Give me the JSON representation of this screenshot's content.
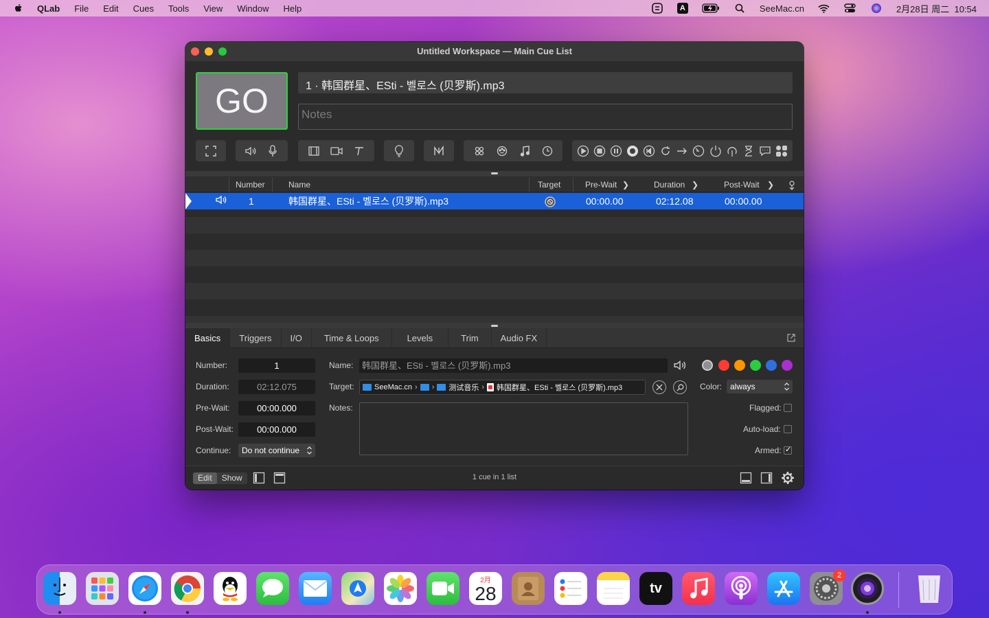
{
  "menubar": {
    "app_name": "QLab",
    "items": [
      "File",
      "Edit",
      "Cues",
      "Tools",
      "View",
      "Window",
      "Help"
    ],
    "status": {
      "site": "SeeMac.cn",
      "datetime": "2月28日 周二  10:54",
      "input_source": "A"
    }
  },
  "window": {
    "title": "Untitled Workspace — Main Cue List",
    "go_label": "GO",
    "current_cue": "1 · 韩国群星、ESti - 벨로스 (贝罗斯).mp3",
    "notes_placeholder": "Notes"
  },
  "toolbar": {
    "groups": [
      [
        "fullscreen-icon"
      ],
      [
        "audio-cue-icon",
        "mic-cue-icon"
      ],
      [
        "video-cue-icon",
        "camera-cue-icon",
        "text-cue-icon"
      ],
      [
        "light-cue-icon"
      ],
      [
        "fade-cue-icon"
      ],
      [
        "network-cue-icon",
        "midi-cue-icon",
        "music-cue-icon",
        "timecode-cue-icon"
      ],
      [
        "start-icon",
        "stop-icon",
        "pause-icon",
        "load-icon",
        "reset-icon",
        "devamp-icon",
        "goto-icon",
        "target-icon",
        "arm-icon",
        "disarm-icon",
        "wait-icon",
        "memo-icon",
        "group-icon"
      ]
    ]
  },
  "cue_list": {
    "columns": [
      "Number",
      "Name",
      "Target",
      "Pre-Wait",
      "Duration",
      "Post-Wait"
    ],
    "rows": [
      {
        "number": "1",
        "name": "韩国群星、ESti - 벨로스 (贝罗斯).mp3",
        "pre_wait": "00:00.00",
        "duration": "02:12.08",
        "post_wait": "00:00.00",
        "selected": true
      }
    ]
  },
  "inspector": {
    "tabs": [
      "Basics",
      "Triggers",
      "I/O",
      "Time & Loops",
      "Levels",
      "Trim",
      "Audio FX"
    ],
    "active_tab": "Basics",
    "labels": {
      "number": "Number:",
      "duration": "Duration:",
      "pre_wait": "Pre-Wait:",
      "post_wait": "Post-Wait:",
      "continue": "Continue:",
      "name": "Name:",
      "target": "Target:",
      "notes": "Notes:",
      "color": "Color:",
      "flagged": "Flagged:",
      "auto_load": "Auto-load:",
      "armed": "Armed:"
    },
    "values": {
      "number": "1",
      "duration": "02:12.075",
      "pre_wait": "00:00.000",
      "post_wait": "00:00.000",
      "continue": "Do not continue",
      "name": "韩国群星、ESti - 벨로스 (贝罗斯).mp3",
      "color_mode": "always"
    },
    "target_path": [
      "SeeMac.cn",
      "",
      "测试音乐",
      "韩国群星、ESti - 벨로스 (贝罗斯).mp3"
    ],
    "colors": [
      "#8e8e93",
      "#ff3b30",
      "#ff9500",
      "#28cd41",
      "#2f6fe0",
      "#a92fd1"
    ],
    "flags": {
      "flagged": false,
      "auto_load": false,
      "armed": true
    }
  },
  "footer": {
    "edit_label": "Edit",
    "show_label": "Show",
    "status": "1 cue in 1 list"
  },
  "dock": {
    "apps": [
      "finder",
      "launchpad",
      "safari",
      "chrome",
      "qq",
      "messages",
      "mail",
      "maps",
      "photos",
      "facetime",
      "calendar",
      "contacts",
      "reminders",
      "notes",
      "tv",
      "music",
      "podcasts",
      "app-store",
      "system-preferences",
      "qlab",
      "trash"
    ],
    "calendar_month": "2月",
    "calendar_day": "28",
    "system_preferences_badge": "2",
    "tv_label": "tv"
  }
}
